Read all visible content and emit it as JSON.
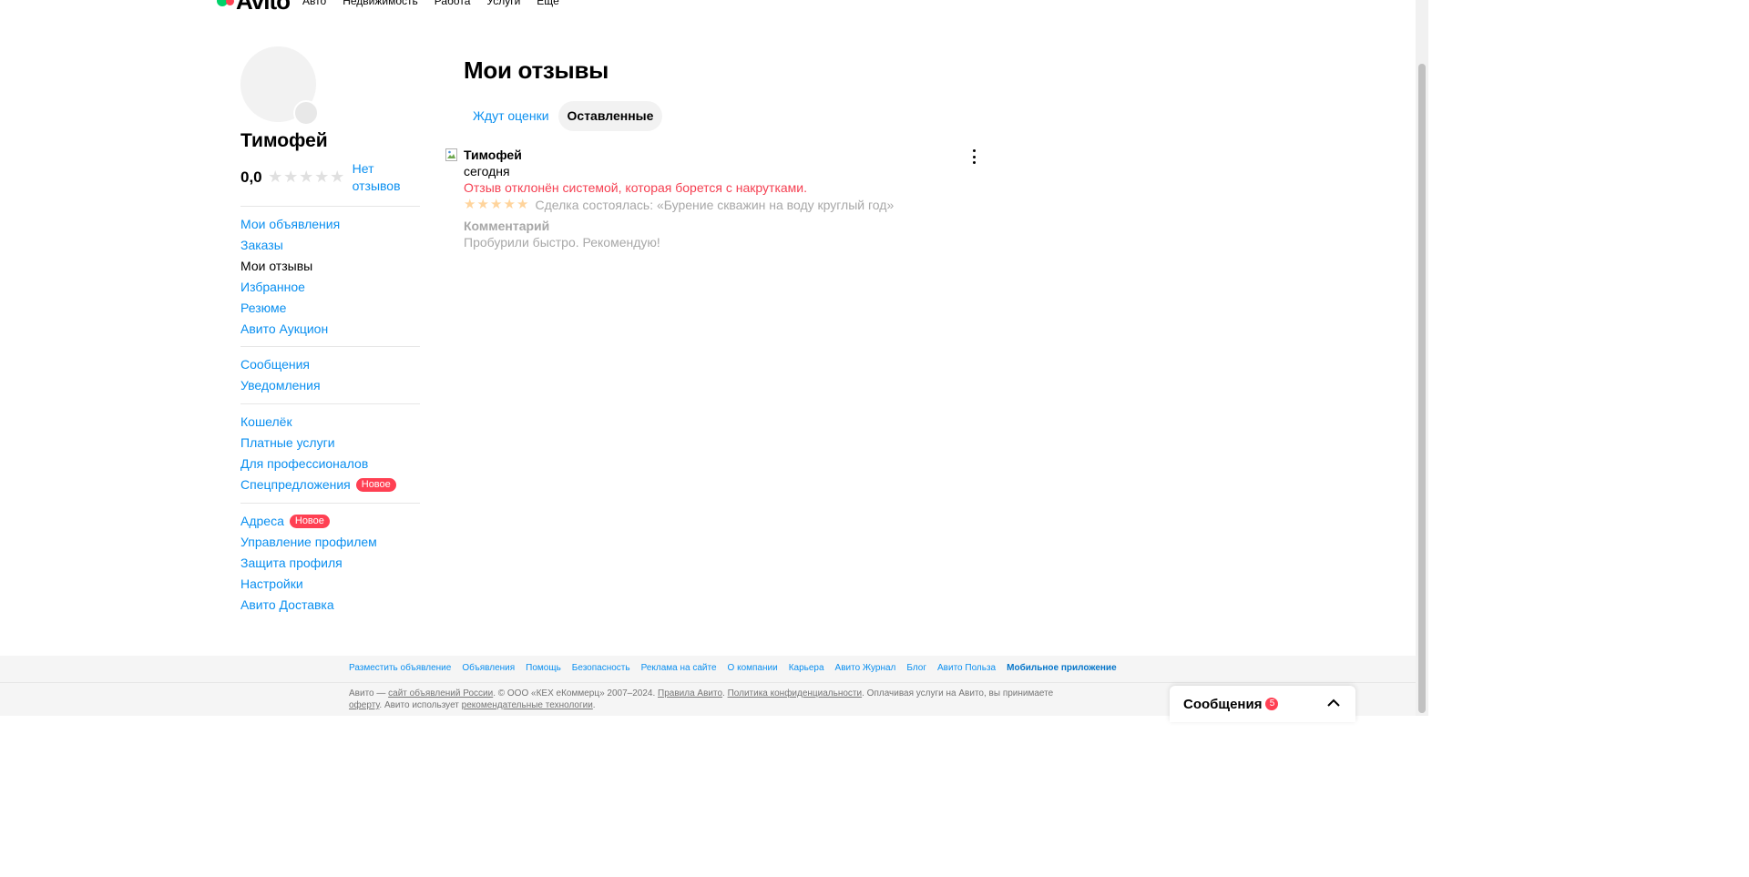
{
  "header": {
    "logo_text": "Avito",
    "logo_dot_colors": [
      "#00d26a",
      "#ff4053"
    ],
    "nav": [
      "Авто",
      "Недвижимость",
      "Работа",
      "Услуги",
      "Ещё"
    ]
  },
  "profile": {
    "name": "Тимофей",
    "rating": "0,0",
    "stars_filled": 0,
    "no_reviews_label": "Нет отзывов"
  },
  "sidebar": {
    "groups": [
      [
        "Мои объявления",
        "Заказы",
        "Мои отзывы",
        "Избранное",
        "Резюме",
        "Авито Аукцион"
      ],
      [
        "Сообщения",
        "Уведомления"
      ],
      [
        "Кошелёк",
        "Платные услуги",
        "Для профессионалов",
        "Спецпредложения"
      ],
      [
        "Адреса",
        "Управление профилем",
        "Защита профиля",
        "Настройки",
        "Авито Доставка"
      ]
    ],
    "active": "Мои отзывы",
    "new_badge": "Новое",
    "new_badge_items": [
      "Спецпредложения",
      "Адреса"
    ]
  },
  "main": {
    "title": "Мои отзывы",
    "tabs": [
      {
        "label": "Ждут оценки",
        "active": false
      },
      {
        "label": "Оставленные",
        "active": true
      }
    ]
  },
  "review": {
    "author": "Тимофей",
    "date": "сегодня",
    "status": "Отзыв отклонён системой, которая борется с накрутками.",
    "stars": 5,
    "deal": "Сделка состоялась: «Бурение скважин на воду круглый год»",
    "comment_label": "Комментарий",
    "comment": "Пробурили быстро. Рекомендую!"
  },
  "footer": {
    "links": [
      "Разместить объявление",
      "Объявления",
      "Помощь",
      "Безопасность",
      "Реклама на сайте",
      "О компании",
      "Карьера",
      "Авито Журнал",
      "Блог",
      "Авито Польза",
      "Мобильное приложение"
    ],
    "legal": {
      "p1": "Авито — ",
      "l1": "сайт объявлений России",
      "p2": ". © ООО «КЕХ еКоммерц» 2007–2024. ",
      "l2": "Правила Авито",
      "p3": ". ",
      "l3": "Политика конфиденциальности",
      "p4": ". Оплачивая услуги на Авито, вы принимаете ",
      "l4": "оферту",
      "p5": ". Авито использует ",
      "l5": "рекомендательные технологии",
      "p6": "."
    }
  },
  "messages_widget": {
    "title": "Сообщения",
    "count": "5"
  }
}
